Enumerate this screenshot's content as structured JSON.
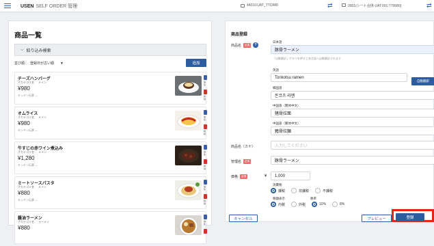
{
  "header": {
    "brand_main": "USEN",
    "brand_sub": "SELF ORDER 管理",
    "store_id": "44010:UAT_TTO/M0",
    "shop_name": "0001(シート合併-UAT:001-770680)"
  },
  "list": {
    "title": "商品一覧",
    "filter_label": "絞り込み検索",
    "sort_prefix": "並び順：",
    "sort_value": "登録日が古い順",
    "add_label": "追加",
    "items": [
      {
        "name": "チーズハンバーグ",
        "sub": "子カテゴリ名",
        "cat": "メイン",
        "price": "¥980",
        "kitchen": "キッチン伝票 ―",
        "photo": "hamburg"
      },
      {
        "name": "オムライス",
        "sub": "子カテゴリ名",
        "cat": "メイン",
        "price": "¥980",
        "kitchen": "キッチン伝票 ―",
        "photo": "omurice"
      },
      {
        "name": "牛すじの赤ワイン煮込み",
        "sub": "子カテゴリ名",
        "cat": "メイン",
        "price": "¥1,280",
        "kitchen": "キッチン伝票 ―",
        "photo": "stew"
      },
      {
        "name": "ミートソースパスタ",
        "sub": "子カテゴリ名",
        "cat": "メイン",
        "price": "¥880",
        "kitchen": "キッチン伝票 ―",
        "photo": "pasta"
      },
      {
        "name": "醤油ラーメン",
        "sub": "子カテゴリ名",
        "cat": "ラーメン",
        "price": "¥880",
        "kitchen": "",
        "photo": "ramen"
      }
    ],
    "edit_label": "編集",
    "delete_label": "削除"
  },
  "form": {
    "title": "商品登録",
    "name_label": "商品名",
    "required": "必須",
    "ja_label": "日本語",
    "ja_value": "豚骨ラーメン",
    "auto_hint": "「自動翻訳」ボタンを押すと各言語へ自動翻訳されます",
    "auto_btn": "自動翻訳",
    "en_label": "英語",
    "en_value": "Tonkotsu ramen",
    "ko_label": "韓国語",
    "ko_value": "돈코츠 라멘",
    "zhs_label": "中国語（簡体中文）",
    "zhs_value": "猪骨拉面",
    "zht_label": "中国語（繁体中文）",
    "zht_value": "豬骨拉麵",
    "kana_label": "商品名（カナ）",
    "kana_placeholder": "入力してください",
    "mgmt_label": "管理名",
    "mgmt_value": "豚骨ラーメン",
    "price_label": "価格",
    "price_value": "1,000",
    "tax_label": "消費税",
    "tax_opts": [
      "課税",
      "非課税",
      "不課税"
    ],
    "taxdisp_label": "税額表示",
    "taxdisp_opts": [
      "内税",
      "外税"
    ],
    "rate_label": "税率",
    "rate_opts": [
      "10%",
      "8%"
    ],
    "cancel": "キャンセル",
    "preview": "プレビュー",
    "save": "登録"
  }
}
